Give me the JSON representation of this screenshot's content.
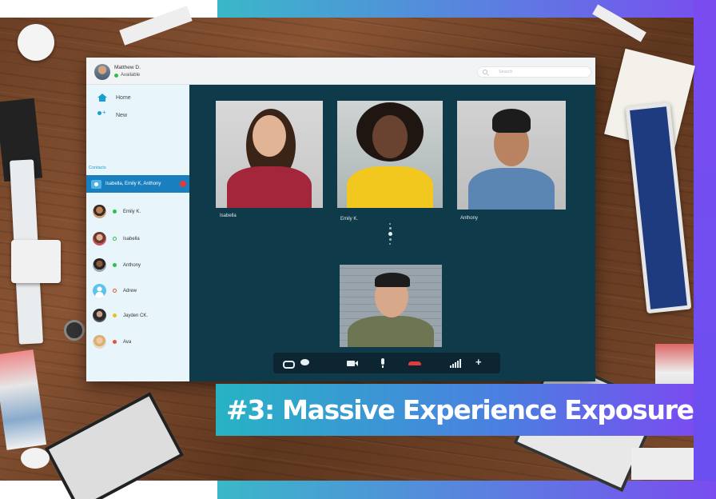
{
  "user": {
    "name": "Matthew D.",
    "status": "Available",
    "status_color": "#2fbf4a"
  },
  "search": {
    "placeholder": "Search"
  },
  "sidebar": {
    "nav": [
      {
        "label": "Home",
        "icon": "home-icon"
      },
      {
        "label": "New",
        "icon": "add-user-icon"
      }
    ],
    "contacts_label": "Contacts",
    "active_group": "Isabella, Emily K, Anthony",
    "contacts": [
      {
        "name": "Emily K.",
        "status": "online"
      },
      {
        "name": "Isabella",
        "status": "available-ring"
      },
      {
        "name": "Anthony",
        "status": "online"
      },
      {
        "name": "Adrew",
        "status": "offline-ring"
      },
      {
        "name": "Jayden CK.",
        "status": "away"
      },
      {
        "name": "Ava",
        "status": "busy"
      }
    ]
  },
  "call": {
    "participants": [
      {
        "name": "Isabella"
      },
      {
        "name": "Emily K."
      },
      {
        "name": "Anthony"
      }
    ],
    "controls": [
      "link-icon",
      "chat-icon",
      "video-icon",
      "mic-icon",
      "hang-up-icon",
      "signal-icon",
      "add-icon"
    ]
  },
  "banner": {
    "text": "#3: Massive Experience Exposure"
  },
  "colors": {
    "accent": "#1a9fd0",
    "stage": "#0f3a4a",
    "hangup": "#e23b3b"
  }
}
